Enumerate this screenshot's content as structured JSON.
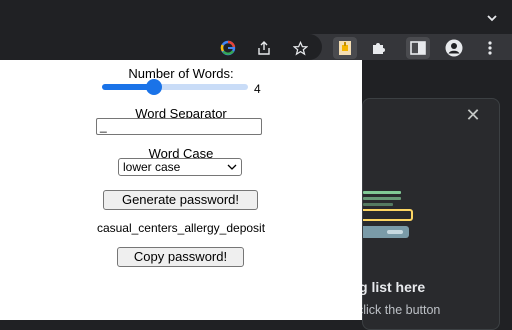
{
  "browser": {
    "icons": [
      "google-icon",
      "share-icon",
      "star-icon",
      "passphrase-extension-icon",
      "puzzle-icon",
      "side-panel-icon",
      "profile-icon",
      "more-icon",
      "chevron-down-icon"
    ]
  },
  "popup": {
    "words_label": "Number of Words:",
    "words_value": "4",
    "separator_label": "Word Separator",
    "separator_value": "_",
    "case_label": "Word Case",
    "case_value": "lower case",
    "generate_label": "Generate password!",
    "password": "casual_centers_allergy_deposit",
    "copy_label": "Copy password!"
  },
  "side_panel": {
    "heading_partial": "g list here",
    "sub_partial": "click the button"
  },
  "colors": {
    "accent": "#1a73e8",
    "illustration_green": "#81c995",
    "illustration_yellow": "#fdd663"
  }
}
